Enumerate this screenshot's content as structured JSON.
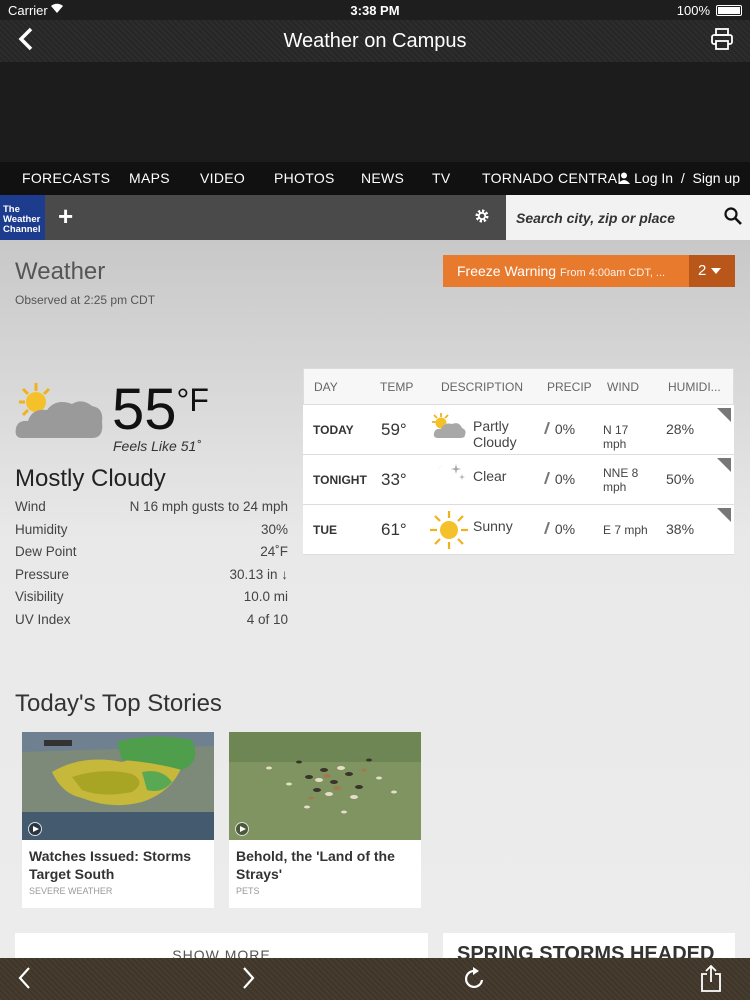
{
  "status": {
    "carrier": "Carrier",
    "time": "3:38 PM",
    "battery": "100%"
  },
  "app": {
    "title": "Weather on Campus"
  },
  "nav": {
    "items": [
      "FORECASTS",
      "MAPS",
      "VIDEO",
      "PHOTOS",
      "NEWS",
      "TV",
      "TORNADO CENTRAL"
    ],
    "login": "Log In",
    "separator": "/",
    "signup": "Sign up"
  },
  "toolbar": {
    "logo_line1": "The",
    "logo_line2": "Weather",
    "logo_line3": "Channel",
    "search_placeholder": "Search city, zip or place"
  },
  "current": {
    "heading": "Weather",
    "observed": "Observed at 2:25 pm CDT",
    "temp": "55",
    "unit": "°F",
    "feels_like": "Feels Like 51˚",
    "phrase": "Mostly Cloudy",
    "details": [
      {
        "label": "Wind",
        "value": "N 16 mph gusts to 24 mph"
      },
      {
        "label": "Humidity",
        "value": "30%"
      },
      {
        "label": "Dew Point",
        "value": "24˚F"
      },
      {
        "label": "Pressure",
        "value": "30.13 in ↓"
      },
      {
        "label": "Visibility",
        "value": "10.0 mi"
      },
      {
        "label": "UV Index",
        "value": "4 of 10"
      }
    ]
  },
  "alert": {
    "title": "Freeze Warning",
    "subtitle": "From 4:00am CDT, ...",
    "count": "2"
  },
  "forecast": {
    "headers": {
      "day": "DAY",
      "temp": "TEMP",
      "description": "DESCRIPTION",
      "precip": "PRECIP",
      "wind": "WIND",
      "humidity": "HUMIDI..."
    },
    "rows": [
      {
        "day": "TODAY",
        "temp": "59°",
        "icon": "partly-cloudy-icon",
        "description": "Partly Cloudy",
        "precip": "0%",
        "wind": "N 17 mph",
        "humidity": "28%"
      },
      {
        "day": "TONIGHT",
        "temp": "33°",
        "icon": "moon-icon",
        "description": "Clear",
        "precip": "0%",
        "wind": "NNE 8 mph",
        "humidity": "50%"
      },
      {
        "day": "TUE",
        "temp": "61°",
        "icon": "sun-icon",
        "description": "Sunny",
        "precip": "0%",
        "wind": "E 7 mph",
        "humidity": "38%"
      }
    ]
  },
  "stories": {
    "heading": "Today's Top Stories",
    "items": [
      {
        "title": "Watches Issued: Storms Target South",
        "category": "SEVERE WEATHER"
      },
      {
        "title": "Behold, the 'Land of the Strays'",
        "category": "PETS"
      }
    ],
    "show_more": "SHOW MORE",
    "spring_title": "SPRING STORMS HEADED"
  },
  "colors": {
    "alert": "#e87a2e",
    "alert_dark": "#b9571a",
    "logo": "#1d3c8e"
  }
}
